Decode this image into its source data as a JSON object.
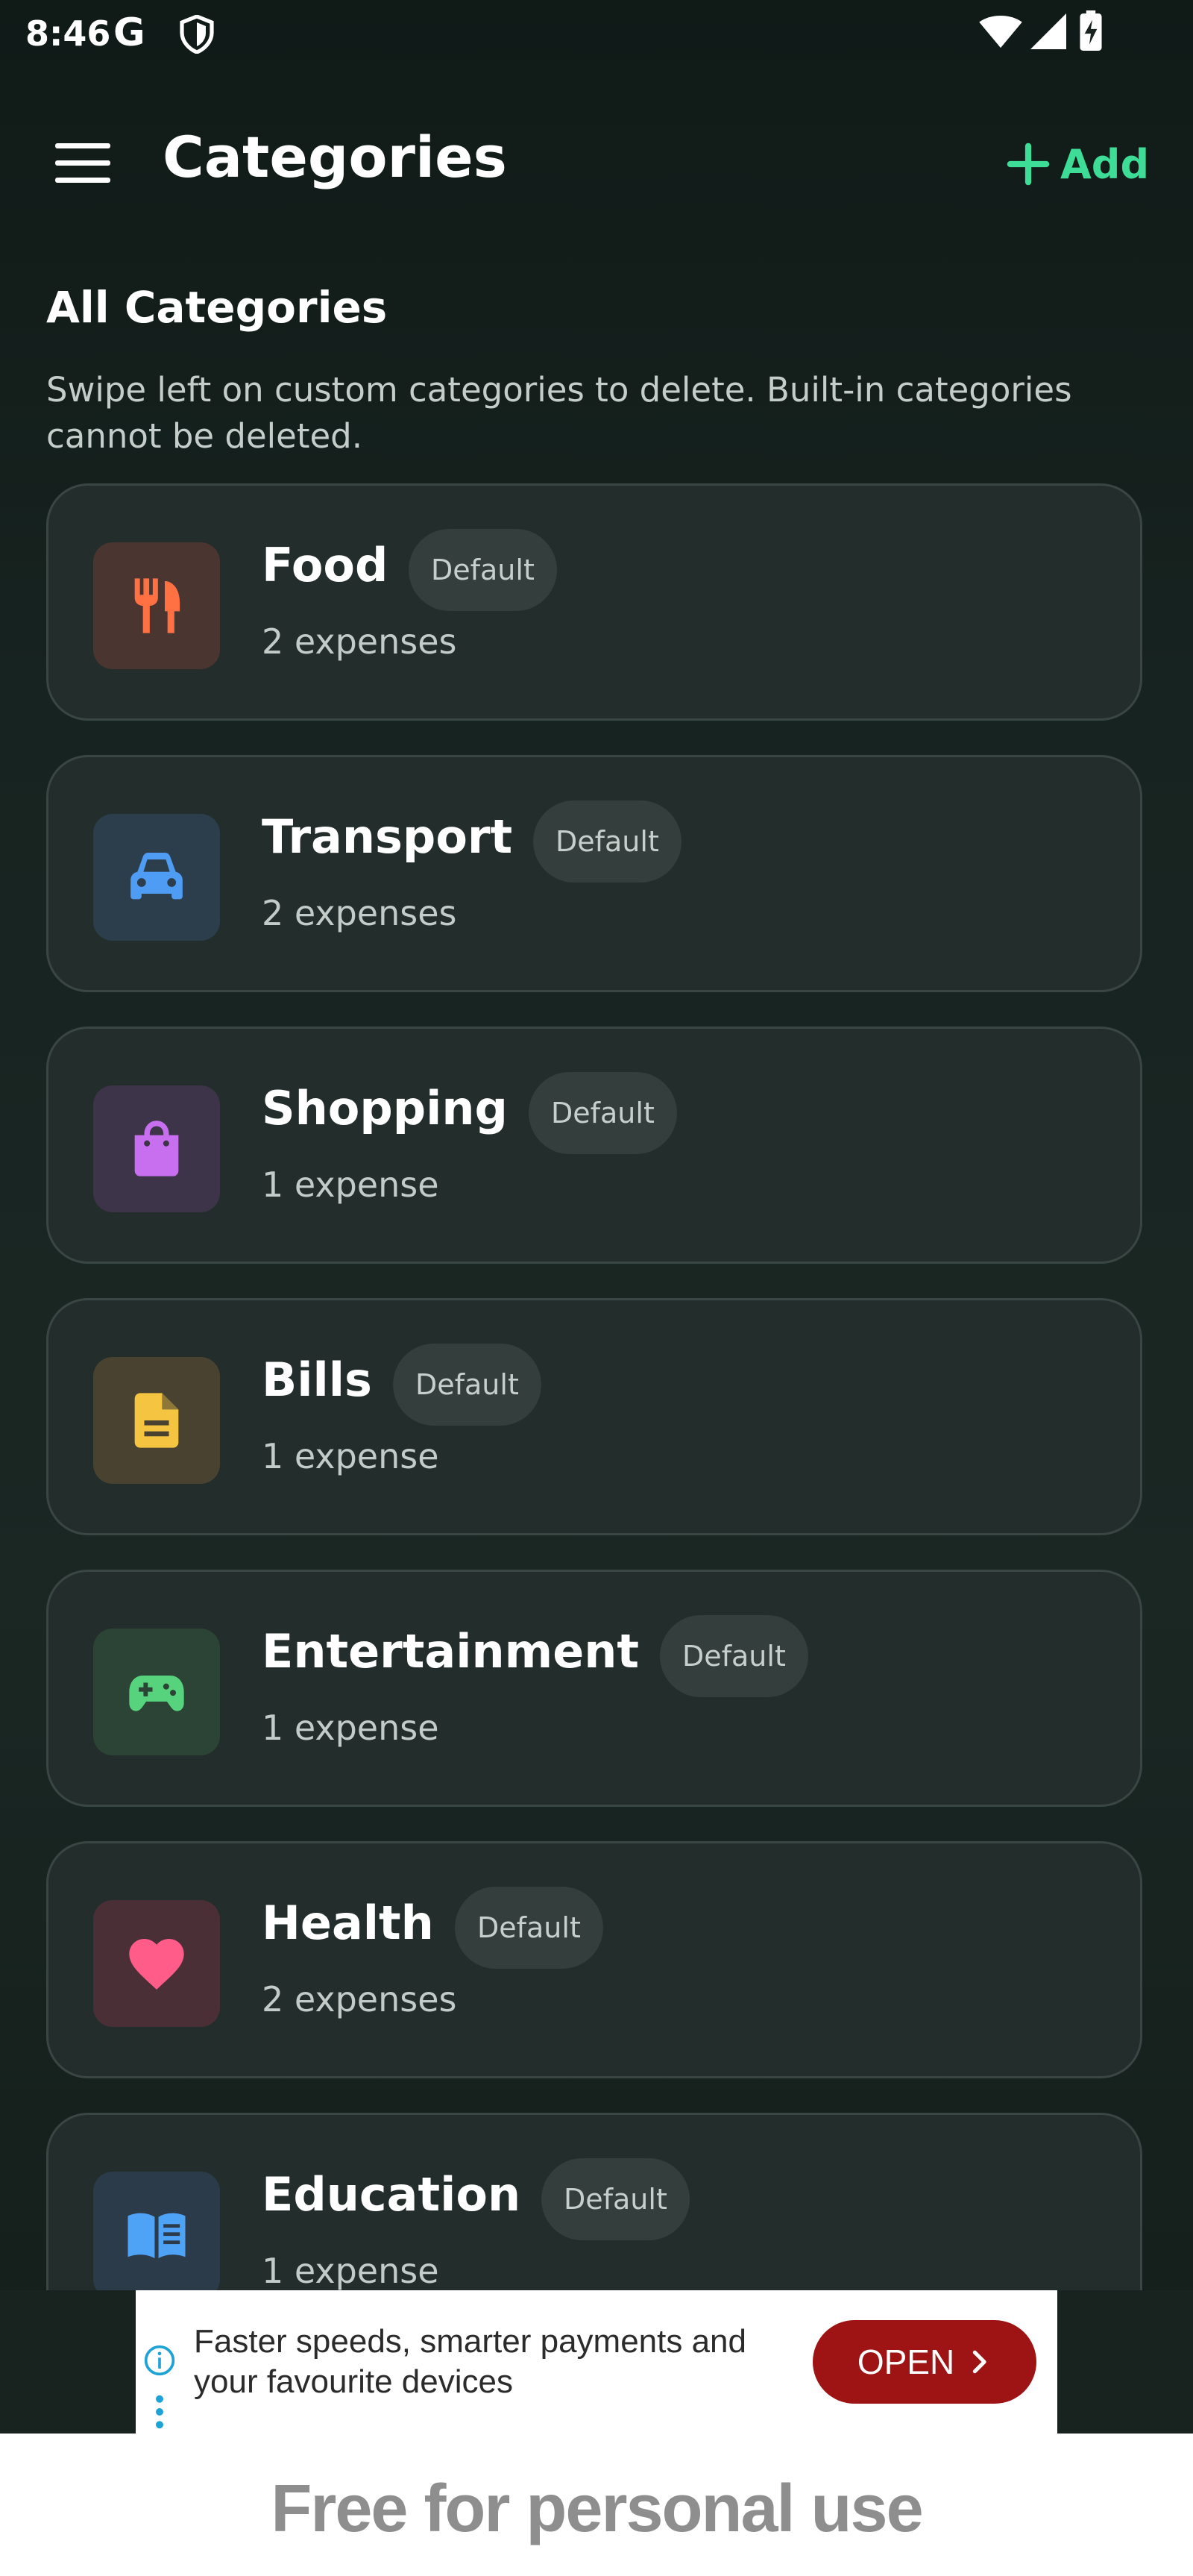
{
  "status_bar": {
    "time": "8:46",
    "g_icon": "G"
  },
  "app_bar": {
    "title": "Categories",
    "add_label": "Add"
  },
  "section": {
    "title": "All Categories",
    "hint": "Swipe left on custom categories to delete. Built-in categories cannot be deleted."
  },
  "categories": [
    {
      "name": "Food",
      "badge": "Default",
      "count": "2 expenses",
      "icon": "fork-knife-icon",
      "color": "#ff7043",
      "tile": "#4a3530"
    },
    {
      "name": "Transport",
      "badge": "Default",
      "count": "2 expenses",
      "icon": "car-icon",
      "color": "#4f9cf5",
      "tile": "#2c3d4c"
    },
    {
      "name": "Shopping",
      "badge": "Default",
      "count": "1 expense",
      "icon": "shopping-bag-icon",
      "color": "#c86ff0",
      "tile": "#3e3449"
    },
    {
      "name": "Bills",
      "badge": "Default",
      "count": "1 expense",
      "icon": "document-icon",
      "color": "#f5c542",
      "tile": "#4a4230"
    },
    {
      "name": "Entertainment",
      "badge": "Default",
      "count": "1 expense",
      "icon": "gamepad-icon",
      "color": "#57d27d",
      "tile": "#2c4436"
    },
    {
      "name": "Health",
      "badge": "Default",
      "count": "2 expenses",
      "icon": "heart-icon",
      "color": "#ff5c8a",
      "tile": "#4a3036"
    },
    {
      "name": "Education",
      "badge": "Default",
      "count": "1 expense",
      "icon": "book-icon",
      "color": "#4fa3f7",
      "tile": "#2c3b4a"
    }
  ],
  "ad": {
    "text": "Faster speeds, smarter payments and your favourite devices",
    "open_label": "OPEN"
  },
  "watermark": "Free for personal use"
}
